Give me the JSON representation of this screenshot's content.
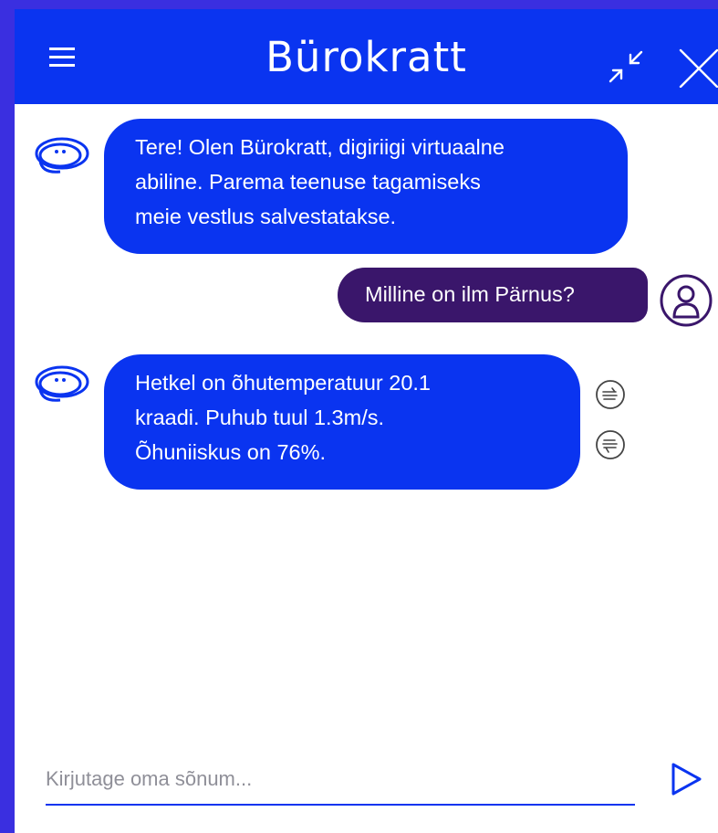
{
  "header": {
    "title": "Bürokratt"
  },
  "messages": [
    {
      "author": "bot",
      "lines": [
        "Tere! Olen Bürokratt, digiriigi virtuaalne",
        "abiline. Parema teenuse tagamiseks",
        "meie vestlus salvestatakse."
      ]
    },
    {
      "author": "user",
      "text": "Milline on ilm Pärnus?"
    },
    {
      "author": "bot",
      "lines": [
        "Hetkel on õhutemperatuur 20.1",
        "kraadi. Puhub tuul 1.3m/s.",
        "Õhuniiskus on 76%."
      ]
    }
  ],
  "composer": {
    "placeholder": "Kirjutage oma sõnum..."
  },
  "icons": {
    "menu": "hamburger-menu-icon",
    "minimize": "minimize-icon",
    "close": "close-icon",
    "bot_avatar": "bot-avatar-icon",
    "user_avatar": "user-avatar-icon",
    "thumbs_up": "thumbs-up-icon",
    "thumbs_down": "thumbs-down-icon",
    "send": "send-icon"
  },
  "colors": {
    "brand_blue": "#0a34f0",
    "user_bubble": "#3a166b",
    "page_background": "#3a2fe0"
  }
}
